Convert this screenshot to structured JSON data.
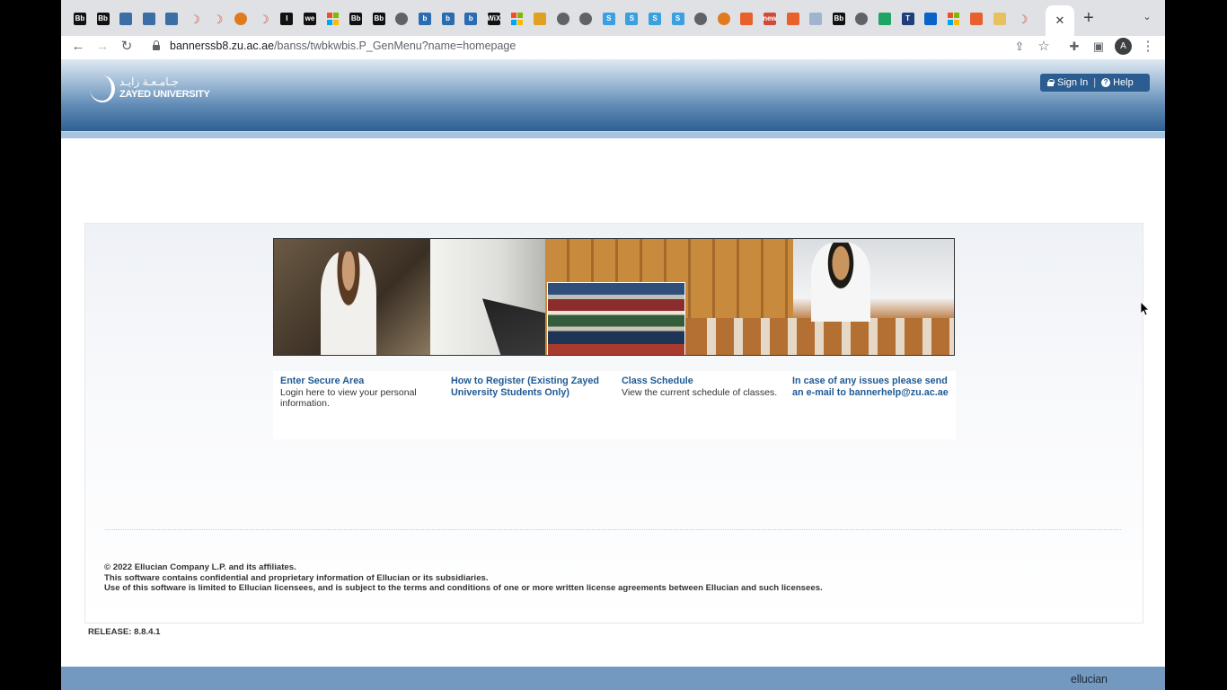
{
  "browser": {
    "tabs": [
      {
        "icon": "bb-icon",
        "text": "Bb",
        "color": "#111111"
      },
      {
        "icon": "bb-icon",
        "text": "Bb",
        "color": "#111111"
      },
      {
        "icon": "teams-icon",
        "text": "",
        "color": "#3a6ea5"
      },
      {
        "icon": "teams-icon",
        "text": "",
        "color": "#3a6ea5"
      },
      {
        "icon": "teams-icon",
        "text": "",
        "color": "#3a6ea5"
      },
      {
        "icon": "zu-moon-icon",
        "text": "",
        "color": "#d04a3a"
      },
      {
        "icon": "zu-moon-icon",
        "text": "",
        "color": "#d04a3a"
      },
      {
        "icon": "orange-globe-icon",
        "text": "",
        "color": "#e07a1f"
      },
      {
        "icon": "zu-moon-icon",
        "text": "",
        "color": "#d04a3a"
      },
      {
        "icon": "i-icon",
        "text": "I",
        "color": "#111111"
      },
      {
        "icon": "we-icon",
        "text": "we",
        "color": "#111111"
      },
      {
        "icon": "microsoft-icon",
        "text": "",
        "color": "#f25022"
      },
      {
        "icon": "bb-icon",
        "text": "Bb",
        "color": "#111111"
      },
      {
        "icon": "bb-icon",
        "text": "Bb",
        "color": "#111111"
      },
      {
        "icon": "globe-icon",
        "text": "",
        "color": "#5f6368"
      },
      {
        "icon": "b-icon",
        "text": "b",
        "color": "#2b6cb0"
      },
      {
        "icon": "b-icon",
        "text": "b",
        "color": "#2b6cb0"
      },
      {
        "icon": "b-icon",
        "text": "b",
        "color": "#2b6cb0"
      },
      {
        "icon": "wix-icon",
        "text": "WiX",
        "color": "#111111"
      },
      {
        "icon": "microsoft-icon",
        "text": "",
        "color": "#f25022"
      },
      {
        "icon": "grid-icon",
        "text": "",
        "color": "#e0a020"
      },
      {
        "icon": "globe-icon",
        "text": "",
        "color": "#5f6368"
      },
      {
        "icon": "globe-icon",
        "text": "",
        "color": "#5f6368"
      },
      {
        "icon": "s-icon",
        "text": "S",
        "color": "#3aa0e0"
      },
      {
        "icon": "s-icon",
        "text": "S",
        "color": "#3aa0e0"
      },
      {
        "icon": "s-icon",
        "text": "S",
        "color": "#3aa0e0"
      },
      {
        "icon": "s-icon",
        "text": "S",
        "color": "#3aa0e0"
      },
      {
        "icon": "globe-icon",
        "text": "",
        "color": "#5f6368"
      },
      {
        "icon": "orange-globe-icon",
        "text": "",
        "color": "#e07a1f"
      },
      {
        "icon": "orange-flag-icon",
        "text": "",
        "color": "#e8602c"
      },
      {
        "icon": "new-icon",
        "text": "new",
        "color": "#d04a3a"
      },
      {
        "icon": "orange-flag-icon",
        "text": "",
        "color": "#e8602c"
      },
      {
        "icon": "blank-icon",
        "text": "",
        "color": "#a0b4d0"
      },
      {
        "icon": "bb-icon",
        "text": "Bb",
        "color": "#111111"
      },
      {
        "icon": "globe-icon",
        "text": "",
        "color": "#5f6368"
      },
      {
        "icon": "drive-icon",
        "text": "",
        "color": "#1fa463"
      },
      {
        "icon": "t-icon",
        "text": "T",
        "color": "#1f3f7a"
      },
      {
        "icon": "outlook-icon",
        "text": "",
        "color": "#0a64c8"
      },
      {
        "icon": "microsoft-icon",
        "text": "",
        "color": "#f25022"
      },
      {
        "icon": "orange-flag-icon",
        "text": "",
        "color": "#e8602c"
      },
      {
        "icon": "yellow-icon",
        "text": "",
        "color": "#e8c060"
      },
      {
        "icon": "zu-moon-icon",
        "text": "",
        "color": "#d04a3a"
      }
    ],
    "active_tab_close": "✕",
    "new_tab": "+",
    "url_host": "bannerssb8.zu.ac.ae",
    "url_path": "/banss/twbkwbis.P_GenMenu?name=homepage",
    "avatar_letter": "A"
  },
  "header": {
    "logo_arabic": "جـامـعـة زايـد",
    "logo_english": "ZAYED UNIVERSITY",
    "sign_in": "Sign In",
    "help": "Help",
    "help_glyph": "?"
  },
  "menu": [
    {
      "title": "Enter Secure Area",
      "desc": "Login here to view your personal information."
    },
    {
      "title": "How to Register (Existing Zayed University Students Only)",
      "desc": ""
    },
    {
      "title": "Class Schedule",
      "desc": "View the current schedule of classes."
    },
    {
      "title": "In case of any issues please send an e-mail to bannerhelp@zu.ac.ae",
      "desc": ""
    }
  ],
  "footer": {
    "copyright": "© 2022 Ellucian Company L.P. and its affiliates.",
    "line2": "This software contains confidential and proprietary information of Ellucian or its subsidiaries.",
    "line3": "Use of this software is limited to Ellucian licensees, and is subject to the terms and conditions of one or more written license agreements between Ellucian and such licensees.",
    "release": "RELEASE: 8.8.4.1",
    "brand": "ellucian"
  }
}
